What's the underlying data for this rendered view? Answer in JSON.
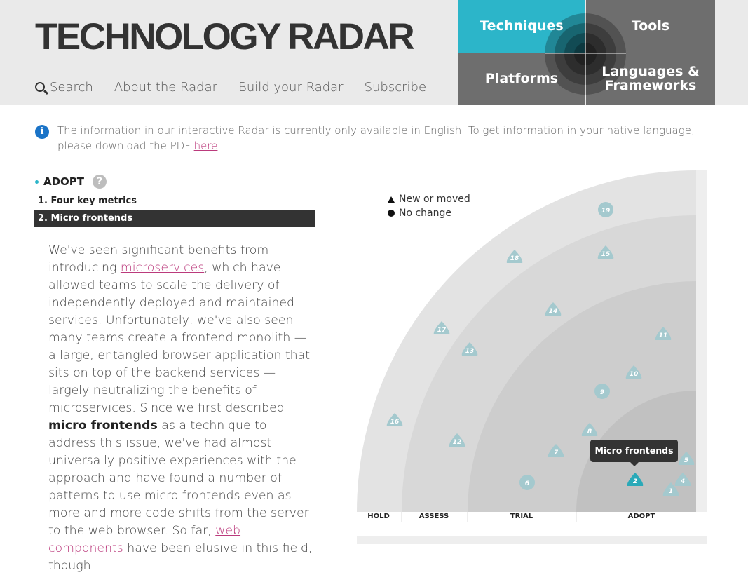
{
  "header": {
    "logo": "TECHNOLOGY RADAR",
    "nav": [
      "Search",
      "About the Radar",
      "Build your Radar",
      "Subscribe"
    ],
    "quadrants": {
      "techniques": "Techniques",
      "tools": "Tools",
      "platforms": "Platforms",
      "languages_line1": "Languages &",
      "languages_line2": "Frameworks"
    },
    "active_quadrant": "Techniques"
  },
  "info": {
    "text": "The information in our interactive Radar is currently only available in English. To get information in your native language, please download the PDF ",
    "link": "here",
    "end": "."
  },
  "ring": {
    "title": "ADOPT",
    "help": "?"
  },
  "blips_list": [
    {
      "label": "1. Four key metrics",
      "active": false
    },
    {
      "label": "2. Micro frontends",
      "active": true
    }
  ],
  "description": {
    "p1": "We've seen significant benefits from introducing ",
    "link1": "microservices",
    "p2": ", which have allowed teams to scale the delivery of independently deployed and maintained services. Unfortunately, we've also seen many teams create a frontend monolith — a large, entangled browser application that sits on top of the backend services — largely neutralizing the benefits of microservices. Since we first described ",
    "bold": "micro frontends",
    "p3": " as a technique to address this issue, we've had almost universally positive experiences with the approach and have found a number of patterns to use micro frontends even as more and more code shifts from the server to the web browser. So far, ",
    "link2": "web components",
    "p4": " have been elusive in this field, though."
  },
  "legend": {
    "new": "New or moved",
    "nochange": "No change"
  },
  "radar": {
    "rings": [
      "HOLD",
      "ASSESS",
      "TRIAL",
      "ADOPT"
    ],
    "tooltip": "Micro frontends",
    "colors": {
      "hold": "#e3e3e3",
      "assess": "#d8d8d8",
      "trial": "#cdcdcd",
      "adopt": "#c1c1c1",
      "blip": "#a4c9ce",
      "active": "#2aa9b8"
    }
  }
}
